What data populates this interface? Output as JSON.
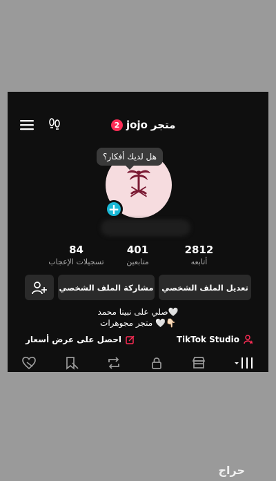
{
  "header": {
    "account_name": "jojo",
    "store_word": "متجر",
    "notification_count": "2"
  },
  "tooltip_text": "هل لديك أفكار؟",
  "stats": [
    {
      "value": "2812",
      "label": "أتابعه"
    },
    {
      "value": "401",
      "label": "متابعين"
    },
    {
      "value": "84",
      "label": "تسجيلات الإعجاب"
    }
  ],
  "buttons": {
    "edit_profile": "تعديل الملف الشخصي",
    "share_profile": "مشاركة الملف الشخصي"
  },
  "bio": {
    "line1": "صلي على نبينا محمد🤍",
    "line2": "متجر مجوهرات 🤍👇🏻"
  },
  "links": {
    "studio": "TikTok Studio",
    "price_offer": "احصل على عرض أسعار"
  },
  "colors": {
    "accent": "#fe2c55",
    "add_button": "#19b8d6",
    "avatar_bg": "#f6dcdf",
    "background": "#0f0f0f"
  },
  "icons": {
    "menu": "hamburger-menu-icon",
    "footprints": "footprints-icon",
    "add_friend": "add-friend-icon",
    "studio": "user-star-icon",
    "quote": "external-edit-icon",
    "tabs": [
      "grid-icon",
      "shop-icon",
      "lock-icon",
      "repost-icon",
      "bookmark-icon",
      "liked-icon"
    ]
  },
  "watermark": "حراج"
}
